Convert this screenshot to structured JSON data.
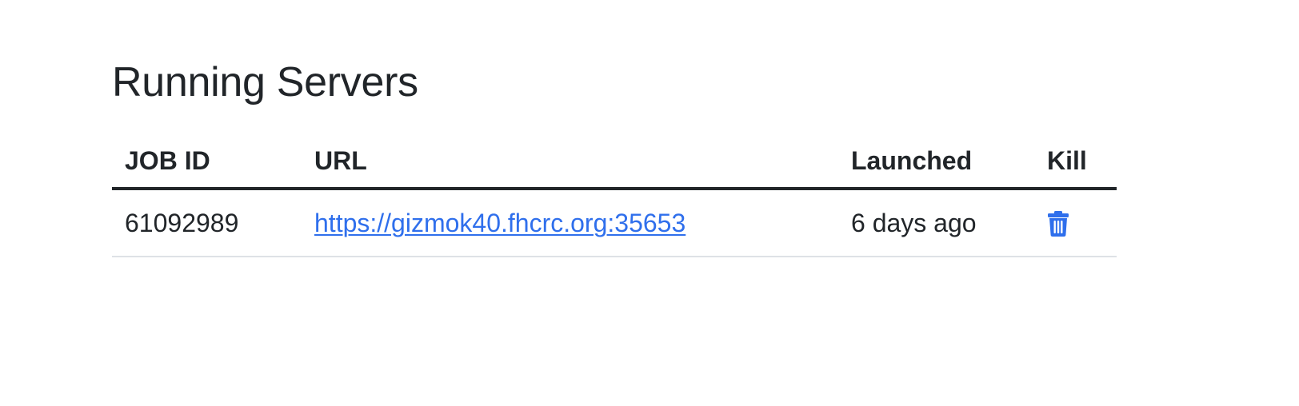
{
  "page": {
    "title": "Running Servers"
  },
  "table": {
    "headers": {
      "job_id": "JOB ID",
      "url": "URL",
      "launched": "Launched",
      "kill": "Kill"
    },
    "rows": [
      {
        "job_id": "61092989",
        "url": "https://gizmok40.fhcrc.org:35653",
        "launched": "6 days ago",
        "kill_icon": "trash-icon"
      }
    ]
  },
  "colors": {
    "text": "#212529",
    "link": "#2f6fec",
    "icon": "#2f6fec",
    "header_border": "#212529",
    "row_border": "#dee2e6"
  }
}
